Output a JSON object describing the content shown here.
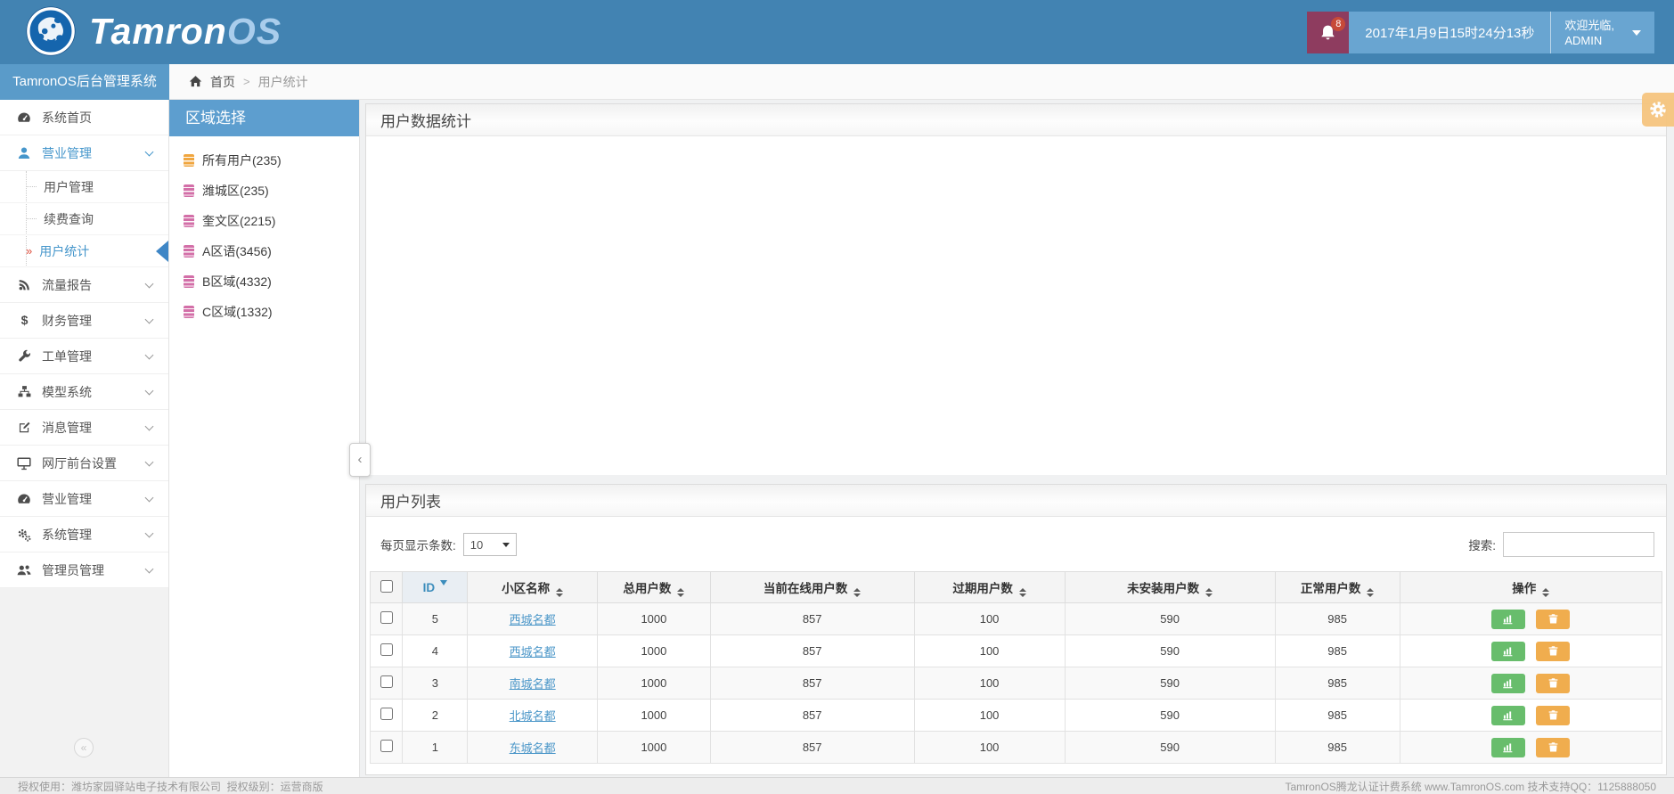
{
  "brand": {
    "logo_primary": "Tamron",
    "logo_secondary": "OS",
    "app_title": "TamronOS后台管理系统"
  },
  "header": {
    "notification_count": "8",
    "datetime": "2017年1月9日15时24分13秒",
    "welcome_line": "欢迎光临,",
    "username": "ADMIN"
  },
  "breadcrumb": {
    "home_label": "首页",
    "separator": ">",
    "current": "用户统计"
  },
  "sidebar": {
    "items": [
      {
        "label": "系统首页",
        "icon": "dashboard-icon"
      },
      {
        "label": "营业管理",
        "icon": "user-icon",
        "expanded": true,
        "children": [
          {
            "label": "用户管理"
          },
          {
            "label": "续费查询"
          },
          {
            "label": "用户统计",
            "active": true
          }
        ]
      },
      {
        "label": "流量报告",
        "icon": "rss-icon"
      },
      {
        "label": "财务管理",
        "icon": "dollar-icon"
      },
      {
        "label": "工单管理",
        "icon": "wrench-icon"
      },
      {
        "label": "模型系统",
        "icon": "sitemap-icon"
      },
      {
        "label": "消息管理",
        "icon": "edit-icon"
      },
      {
        "label": "网厅前台设置",
        "icon": "desktop-icon"
      },
      {
        "label": "营业管理",
        "icon": "dashboard-icon"
      },
      {
        "label": "系统管理",
        "icon": "gears-icon"
      },
      {
        "label": "管理员管理",
        "icon": "users-icon"
      }
    ]
  },
  "region_panel": {
    "title": "区域选择",
    "items": [
      {
        "label": "所有用户(235)",
        "icon_color": "#f0a63f"
      },
      {
        "label": "潍城区(235)",
        "icon_color": "#d36fa8"
      },
      {
        "label": "奎文区(2215)",
        "icon_color": "#d36fa8"
      },
      {
        "label": "A区语(3456)",
        "icon_color": "#d36fa8"
      },
      {
        "label": "B区域(4332)",
        "icon_color": "#d36fa8"
      },
      {
        "label": "C区域(1332)",
        "icon_color": "#d36fa8"
      }
    ]
  },
  "stats_panel": {
    "title": "用户数据统计"
  },
  "list_panel": {
    "title": "用户列表",
    "per_page_label": "每页显示条数:",
    "per_page_value": "10",
    "search_label": "搜索:"
  },
  "table": {
    "columns": [
      {
        "key": "select",
        "label": "",
        "type": "checkbox",
        "width": "2.5%"
      },
      {
        "key": "id",
        "label": "ID",
        "width": "5%",
        "sorted": "desc"
      },
      {
        "key": "name",
        "label": "小区名称",
        "width": "10%",
        "sortable": true
      },
      {
        "key": "total",
        "label": "总用户数",
        "width": "8.7%",
        "sortable": true
      },
      {
        "key": "online",
        "label": "当前在线用户数",
        "width": "15.7%",
        "sortable": true
      },
      {
        "key": "expired",
        "label": "过期用户数",
        "width": "11.6%",
        "sortable": true
      },
      {
        "key": "uninstalled",
        "label": "未安装用户数",
        "width": "16.2%",
        "sortable": true
      },
      {
        "key": "normal",
        "label": "正常用户数",
        "width": "9.6%",
        "sortable": true
      },
      {
        "key": "actions",
        "label": "操作",
        "width": "20.2%",
        "sortable": true
      }
    ],
    "rows": [
      {
        "id": "5",
        "name": "西城名都",
        "total": "1000",
        "online": "857",
        "expired": "100",
        "uninstalled": "590",
        "normal": "985"
      },
      {
        "id": "4",
        "name": "西城名都",
        "total": "1000",
        "online": "857",
        "expired": "100",
        "uninstalled": "590",
        "normal": "985"
      },
      {
        "id": "3",
        "name": "南城名都",
        "total": "1000",
        "online": "857",
        "expired": "100",
        "uninstalled": "590",
        "normal": "985"
      },
      {
        "id": "2",
        "name": "北城名都",
        "total": "1000",
        "online": "857",
        "expired": "100",
        "uninstalled": "590",
        "normal": "985"
      },
      {
        "id": "1",
        "name": "东城名都",
        "total": "1000",
        "online": "857",
        "expired": "100",
        "uninstalled": "590",
        "normal": "985"
      }
    ]
  },
  "footer": {
    "left": "授权使用：潍坊家园驿站电子技术有限公司  授权级别：运营商版",
    "right": "TamronOS腾龙认证计费系统 www.TamronOS.com 技术支持QQ：1125888050"
  },
  "colors": {
    "header_blue": "#4283b2",
    "band_blue": "#5a9bc9",
    "region_header_blue": "#5d9ecf",
    "notification_maroon": "#8e3c5f",
    "userbar_blue": "#69a5d1",
    "accent_blue": "#4596cb",
    "link_blue": "#4a96c8",
    "green_button": "#68bd6c",
    "orange_button": "#f0ad4e",
    "gear_orange": "#f6c57f",
    "active_marker_red": "#dd4b39"
  }
}
